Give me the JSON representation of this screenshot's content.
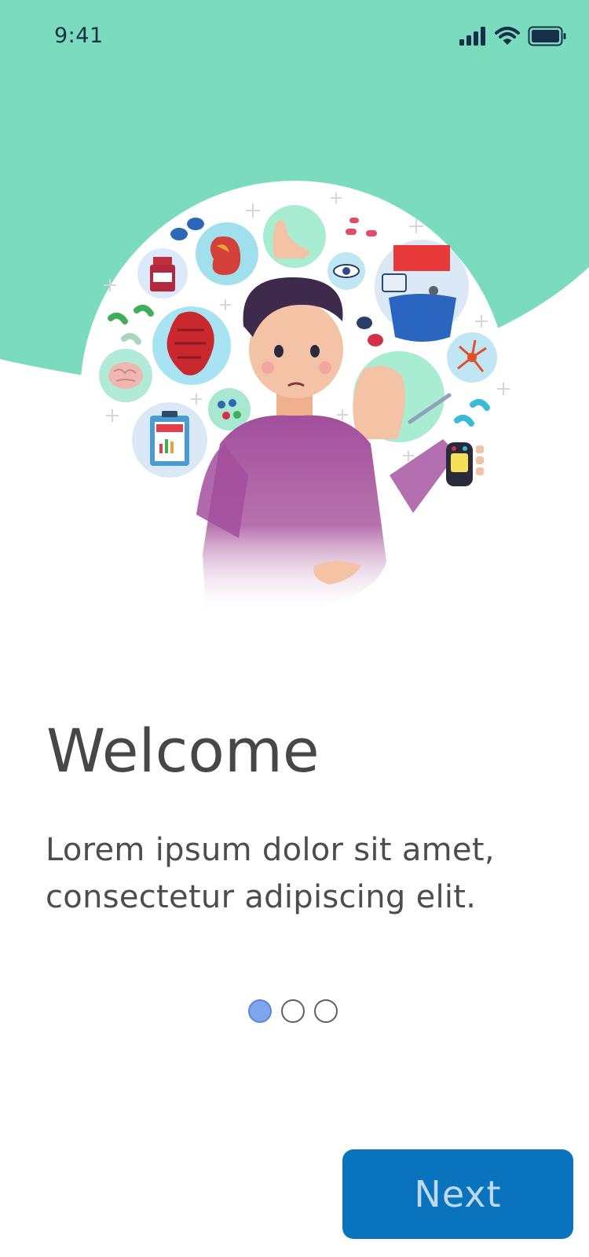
{
  "status_bar": {
    "time": "9:41",
    "icons": [
      "cellular-signal-icon",
      "wifi-icon",
      "battery-icon"
    ]
  },
  "onboarding": {
    "title": "Welcome",
    "subtitle": "Lorem ipsum dolor sit amet, consectetur adipiscing elit.",
    "pagination": {
      "total_pages": 3,
      "current_page": 1
    },
    "next_label": "Next"
  },
  "illustration": {
    "subject": "person surrounded by medical icons",
    "icons": [
      "medicine-bottle-icon",
      "pills-icon",
      "kidney-icon",
      "foot-icon",
      "eye-icon",
      "abdomen-monitor-icon",
      "heart-icon",
      "brain-icon",
      "neuron-icon",
      "clipboard-icon",
      "injection-icon",
      "glucometer-icon"
    ]
  },
  "colors": {
    "accent_mint": "#7adcbc",
    "primary_button": "#0a73be",
    "dot_active": "#7ea6ec",
    "text_dark": "#474747"
  }
}
